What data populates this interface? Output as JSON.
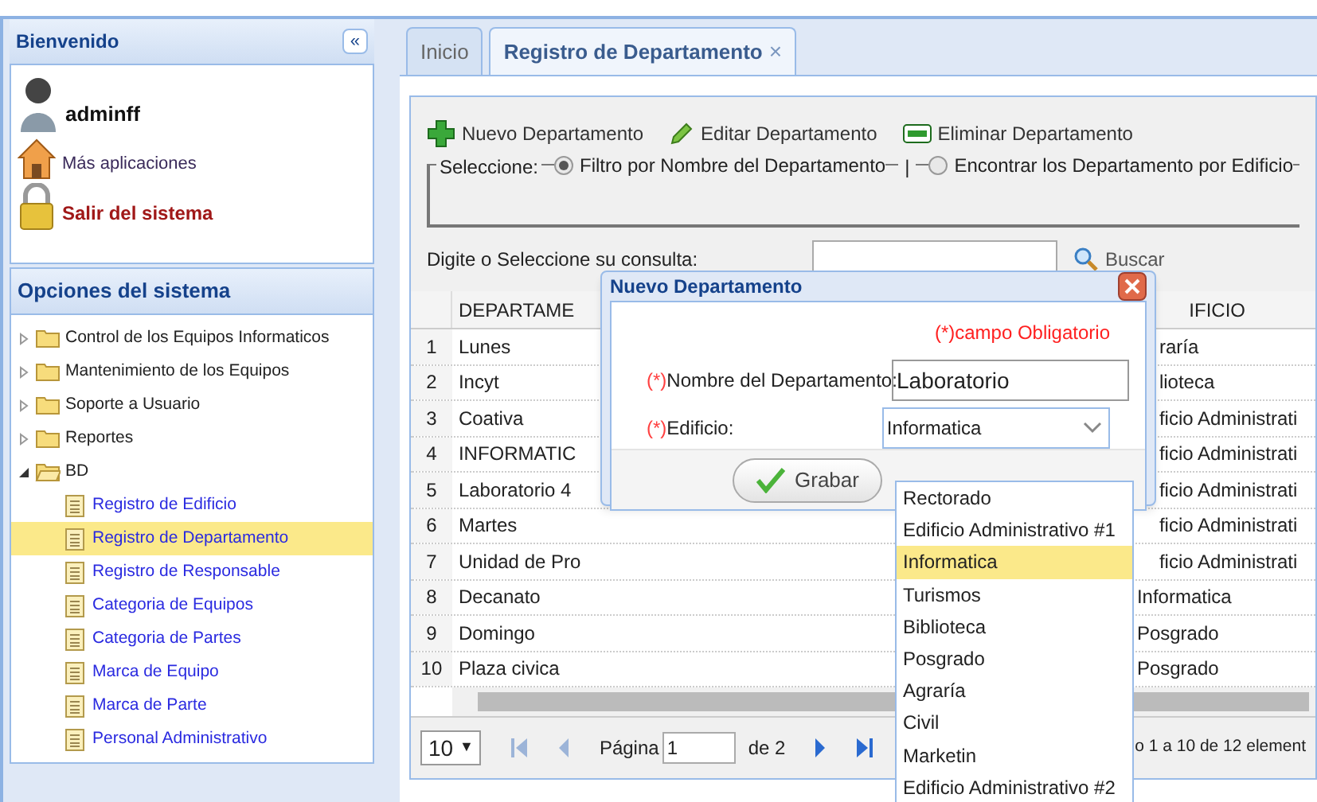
{
  "sidebar": {
    "title": "Bienvenido",
    "collapse_label": "«",
    "user": {
      "name": "adminff",
      "links": [
        {
          "kind": "apps",
          "label": "Más aplicaciones"
        },
        {
          "kind": "logout",
          "label": "Salir del sistema"
        }
      ]
    },
    "menu_title": "Opciones del sistema",
    "tree": [
      {
        "label": "Control de los Equipos Informaticos",
        "expanded": false
      },
      {
        "label": "Mantenimiento de los Equipos",
        "expanded": false
      },
      {
        "label": "Soporte a Usuario",
        "expanded": false
      },
      {
        "label": "Reportes",
        "expanded": false
      },
      {
        "label": "BD",
        "expanded": true,
        "children": [
          {
            "label": "Registro de Edificio",
            "selected": false
          },
          {
            "label": "Registro de Departamento",
            "selected": true
          },
          {
            "label": "Registro de Responsable",
            "selected": false
          },
          {
            "label": "Categoria de Equipos",
            "selected": false
          },
          {
            "label": "Categoria de Partes",
            "selected": false
          },
          {
            "label": "Marca de Equipo",
            "selected": false
          },
          {
            "label": "Marca de Parte",
            "selected": false
          },
          {
            "label": "Personal Administrativo",
            "selected": false
          }
        ]
      }
    ]
  },
  "tabs": [
    {
      "label": "Inicio",
      "selected": false
    },
    {
      "label": "Registro de Departamento",
      "selected": true,
      "close_label": "×"
    }
  ],
  "toolbar": [
    {
      "kind": "add",
      "label": "Nuevo Departamento"
    },
    {
      "kind": "edit",
      "label": "Editar Departamento"
    },
    {
      "kind": "delete",
      "label": "Eliminar Departamento"
    }
  ],
  "filter": {
    "legend": "Seleccione:",
    "separator": "|",
    "options": [
      {
        "label": "Filtro por Nombre del Departamento",
        "selected": true
      },
      {
        "label": "Encontrar los Departamento por Edificio",
        "selected": false
      }
    ]
  },
  "search": {
    "label": "Digite o Seleccione su consulta:",
    "button": "Buscar"
  },
  "table": {
    "columns": [
      "DEPARTAME",
      "IFICIO"
    ],
    "rows": [
      {
        "n": "1",
        "department": "Lunes",
        "building": "raría"
      },
      {
        "n": "2",
        "department": "Incyt",
        "building": "lioteca"
      },
      {
        "n": "3",
        "department": "Coativa",
        "building": "ficio Administrati"
      },
      {
        "n": "4",
        "department": "INFORMATIC",
        "building": "ficio Administrati"
      },
      {
        "n": "5",
        "department": "Laboratorio 4",
        "building": "ficio Administrati"
      },
      {
        "n": "6",
        "department": "Martes",
        "building": "ficio Administrati"
      },
      {
        "n": "7",
        "department": "Unidad de Pro",
        "building": "ficio Administrati"
      },
      {
        "n": "8",
        "department": "Decanato",
        "building": "Informatica"
      },
      {
        "n": "9",
        "department": "Domingo",
        "building": "Posgrado"
      },
      {
        "n": "10",
        "department": "Plaza civica",
        "building": "Posgrado"
      }
    ]
  },
  "pager": {
    "page_size": "10",
    "page_size_caret": "▼",
    "page_label": "Página",
    "page": "1",
    "of": "de 2",
    "summary": "o 1 a 10 de 12 element"
  },
  "dialog": {
    "title": "Nuevo Departamento",
    "required_note": "(*)campo Obligatorio",
    "fields": [
      {
        "kind": "text",
        "required_mark": "(*)",
        "label": "Nombre del Departamento:",
        "value": "Laboratorio"
      },
      {
        "kind": "select",
        "required_mark": "(*)",
        "label": "Edificio:",
        "value": "Informatica"
      }
    ],
    "button": "Grabar",
    "dropdown": [
      {
        "label": "Rectorado",
        "selected": false
      },
      {
        "label": "Edificio Administrativo #1",
        "selected": false
      },
      {
        "label": "Informatica",
        "selected": true
      },
      {
        "label": "Turismos",
        "selected": false
      },
      {
        "label": "Biblioteca",
        "selected": false
      },
      {
        "label": "Posgrado",
        "selected": false
      },
      {
        "label": "Agraría",
        "selected": false
      },
      {
        "label": "Civil",
        "selected": false
      },
      {
        "label": "Marketin",
        "selected": false
      },
      {
        "label": "Edificio Administrativo #2",
        "selected": false
      }
    ]
  }
}
